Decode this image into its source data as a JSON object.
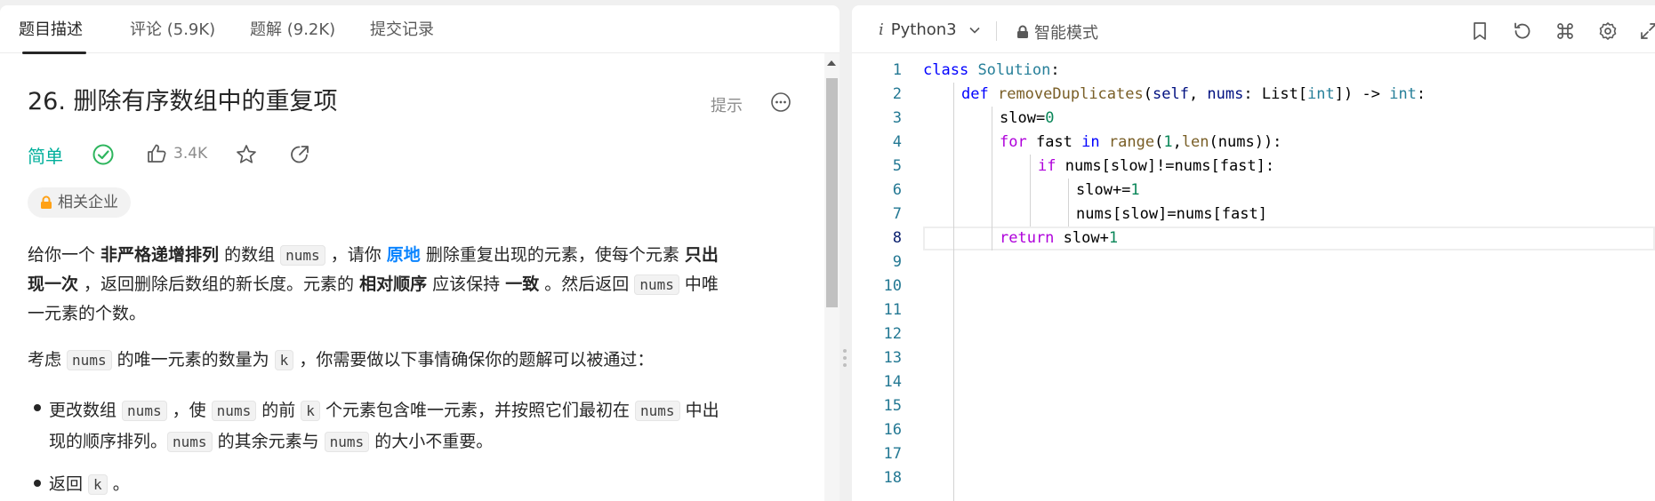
{
  "tabs": [
    {
      "label": "题目描述"
    },
    {
      "label": "评论 (5.9K)"
    },
    {
      "label": "题解 (9.2K)"
    },
    {
      "label": "提交记录"
    }
  ],
  "problem": {
    "title": "26. 删除有序数组中的重复项",
    "hint_label": "提示",
    "difficulty": "简单",
    "likes": "3.4K",
    "company_tag": "相关企业"
  },
  "description": {
    "p1": {
      "t1": "给你一个 ",
      "b1": "非严格递增排列",
      "t2": " 的数组 ",
      "c1": "nums",
      "t3": " ，请你 ",
      "blue": "原地",
      "t4": " 删除重复出现的元素，使每个元素 ",
      "b2": "只出",
      "b3": "现一次",
      "t5": " ，返回删除后数组的新长度。元素的 ",
      "b4": "相对顺序",
      "t6": " 应该保持 ",
      "b5": "一致",
      "t7": " 。然后返回 ",
      "c2": "nums",
      "t8": " 中唯",
      "t9": "一元素的个数。"
    },
    "p2": {
      "t1": "考虑 ",
      "c1": "nums",
      "t2": " 的唯一元素的数量为 ",
      "c2": "k",
      "t3": " ，你需要做以下事情确保你的题解可以被通过："
    },
    "li1": {
      "t1": "更改数组 ",
      "c1": "nums",
      "t2": " ，使 ",
      "c2": "nums",
      "t3": " 的前 ",
      "c3": "k",
      "t4": " 个元素包含唯一元素，并按照它们最初在 ",
      "c4": "nums",
      "t5": " 中出",
      "t6": "现的顺序排列。",
      "c5": "nums",
      "t7": " 的其余元素与 ",
      "c6": "nums",
      "t8": " 的大小不重要。"
    },
    "li2": {
      "t1": "返回 ",
      "c1": "k",
      "t2": " 。"
    }
  },
  "editor": {
    "language": "Python3",
    "mode": "智能模式",
    "line_numbers": [
      "1",
      "2",
      "3",
      "4",
      "5",
      "6",
      "7",
      "8",
      "9",
      "10",
      "11",
      "12",
      "13",
      "14",
      "15",
      "16",
      "17",
      "18"
    ],
    "current_line": "8",
    "code": {
      "l1": {
        "a": "class",
        "b": " ",
        "c": "Solution",
        "d": ":"
      },
      "l2": {
        "a": "def",
        "b": " ",
        "c": "removeDuplicates",
        "d": "(",
        "e": "self",
        "f": ", ",
        "g": "nums",
        "h": ": ",
        "i": "List",
        "j": "[",
        "k": "int",
        "l": "]) -> ",
        "m": "int",
        "n": ":"
      },
      "l3": {
        "a": "slow=",
        "b": "0"
      },
      "l4": {
        "a": "for",
        "b": " fast ",
        "c": "in",
        "d": " ",
        "e": "range",
        "f": "(",
        "g": "1",
        "h": ",",
        "i": "len",
        "j": "(nums)):"
      },
      "l5": {
        "a": "if",
        "b": " nums[slow]!=nums[fast]:"
      },
      "l6": {
        "a": "slow+=",
        "b": "1"
      },
      "l7": {
        "a": "nums[slow]=nums[fast]"
      },
      "l8": {
        "a": "return",
        "b": " slow+",
        "c": "1"
      }
    }
  }
}
